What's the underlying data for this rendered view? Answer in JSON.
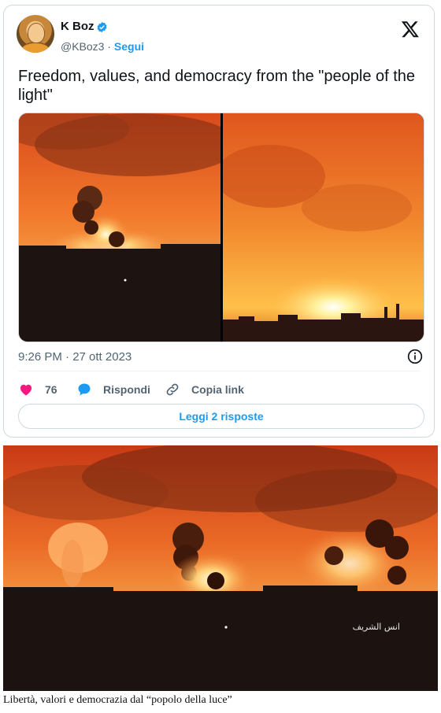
{
  "tweet": {
    "author_name": "K Boz",
    "handle": "@KBoz3",
    "separator": " · ",
    "follow_label": "Segui",
    "text": "Freedom, values, and democracy from the \"people of the light\"",
    "timestamp": "9:26 PM · 27 ott 2023",
    "likes_count": "76",
    "reply_label": "Rispondi",
    "copy_link_label": "Copia link",
    "read_replies_label": "Leggi 2 risposte"
  },
  "icons": {
    "verified": "verified-badge-icon",
    "x_logo": "x-logo-icon",
    "info": "info-icon",
    "heart": "heart-icon",
    "reply": "reply-bubble-icon",
    "link": "link-icon"
  },
  "colors": {
    "accent": "#1d9bf0",
    "like": "#f91880",
    "muted_text": "#536471",
    "border": "#cfd9de"
  },
  "watermark_text": "انس الشريف",
  "caption": "Libertà, valori e democrazia dal “popolo della luce”"
}
